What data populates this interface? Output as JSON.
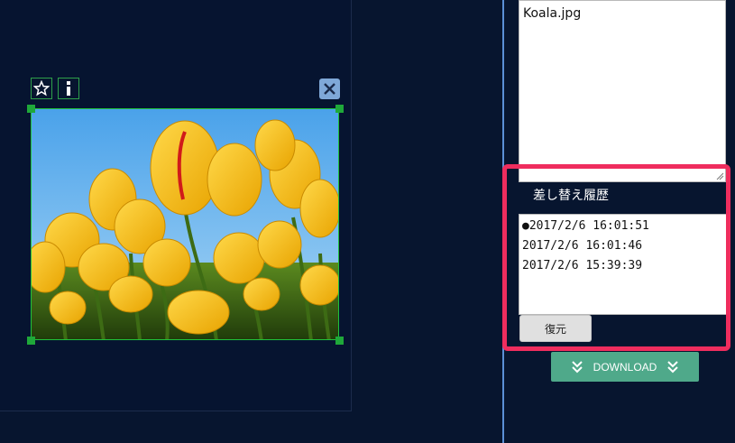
{
  "image_toolbar": {
    "favorite_icon": "star-outline-icon",
    "info_icon": "info-icon",
    "close_icon": "close-icon"
  },
  "image": {
    "description_icon": "tulips-photo"
  },
  "right_panel": {
    "filename_text": "Koala.jpg",
    "history_title": "差し替え履歴",
    "history_items": [
      "●2017/2/6 16:01:51",
      "2017/2/6 16:01:46",
      "2017/2/6 15:39:39"
    ],
    "restore_label": "復元",
    "download_label": "DOWNLOAD"
  },
  "colors": {
    "background": "#07152f",
    "highlight": "#ef2d5e",
    "download": "#4fa98a",
    "frame_border": "#1fc23c"
  }
}
